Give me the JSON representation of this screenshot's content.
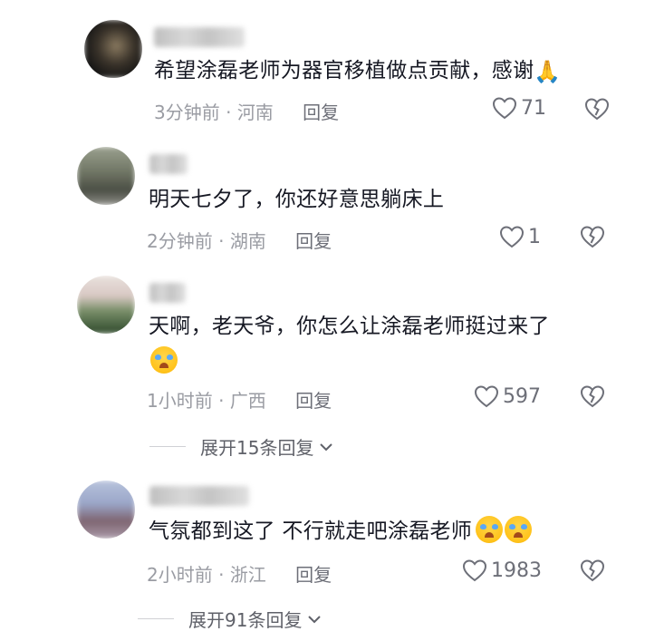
{
  "comments": [
    {
      "text": "希望涂磊老师为器官移植做点贡献，感谢",
      "emoji": "🙏",
      "time": "3分钟前",
      "region": "河南",
      "reply_label": "回复",
      "likes": "71"
    },
    {
      "text": "明天七夕了，你还好意思躺床上",
      "time": "2分钟前",
      "region": "湖南",
      "reply_label": "回复",
      "likes": "1"
    },
    {
      "text_line1": "天啊，老天爷，你怎么让涂磊老师挺过来了",
      "time": "1小时前",
      "region": "广西",
      "reply_label": "回复",
      "likes": "597",
      "expand_label": "展开15条回复"
    },
    {
      "text": "气氛都到这了 不行就走吧涂磊老师",
      "time": "2小时前",
      "region": "浙江",
      "reply_label": "回复",
      "likes": "1983",
      "expand_label": "展开91条回复"
    }
  ],
  "meta_separator": "·",
  "colors": {
    "text": "#161823",
    "meta": "#9a9ca3",
    "icon": "#6d6f78"
  }
}
